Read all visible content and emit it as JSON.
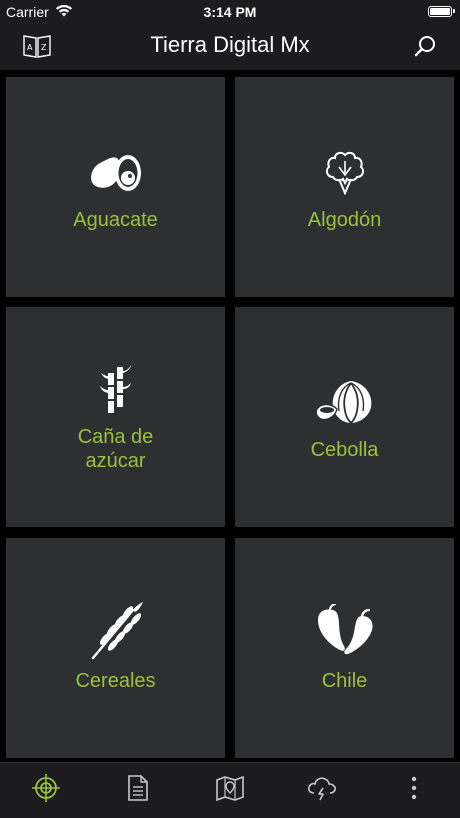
{
  "status_bar": {
    "carrier": "Carrier",
    "time": "3:14 PM"
  },
  "header": {
    "title": "Tierra Digital Mx"
  },
  "crops": [
    {
      "label": "Aguacate",
      "icon": "avocado-icon"
    },
    {
      "label": "Algodón",
      "icon": "cotton-icon"
    },
    {
      "label": "Caña de azúcar",
      "icon": "sugarcane-icon"
    },
    {
      "label": "Cebolla",
      "icon": "onion-icon"
    },
    {
      "label": "Cereales",
      "icon": "wheat-icon"
    },
    {
      "label": "Chile",
      "icon": "chili-icon"
    }
  ],
  "tab_bar": {
    "icons": [
      "target-icon",
      "document-icon",
      "map-icon",
      "storm-cloud-icon",
      "more-icon"
    ],
    "active_tab": "target-icon"
  },
  "colors": {
    "accent": "#9ac23c",
    "tile_background": "#2e2f31",
    "bar_background": "#1c1c1e",
    "background": "#000000"
  }
}
